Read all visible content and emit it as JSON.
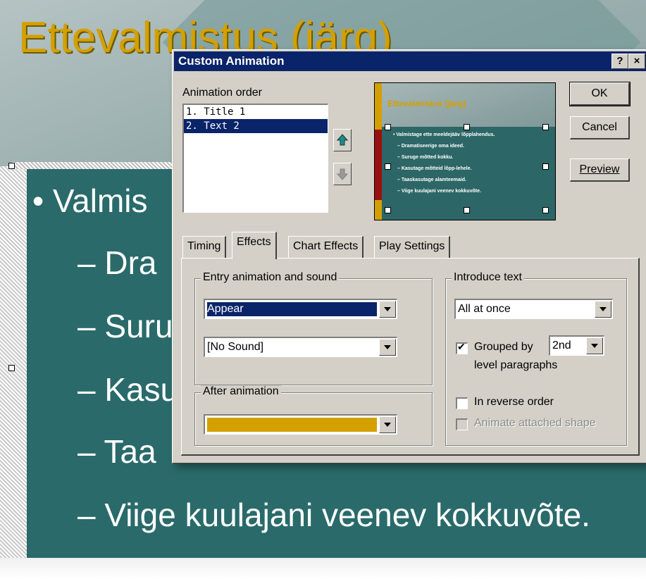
{
  "slide": {
    "title": "Ettevalmistus (järg)",
    "bullets": [
      "• Valmis",
      "– Dra",
      "– Suru",
      "– Kasu",
      "– Taa",
      "– Viige kuulajani veenev kokkuvõte."
    ]
  },
  "dialog": {
    "title": "Custom Animation",
    "help_button": "?",
    "close_button": "×",
    "animation_order_label": "Animation order",
    "order_items": [
      "1. Title 1",
      "2. Text 2"
    ],
    "selected_order_index": 1,
    "buttons": {
      "ok": "OK",
      "cancel": "Cancel",
      "preview": "Preview"
    },
    "preview": {
      "title": "Ettevalmistus (järg)",
      "lines": [
        "• Valmistage ette meeldejääv lõpplahendus.",
        "– Dramatiseerige oma ideed.",
        "– Suruge mõtted kokku.",
        "– Kasutage mõtteid lõpp-lehele.",
        "– Taaskasutage alamteemaid.",
        "– Viige kuulajani veenev kokkuvõte."
      ]
    },
    "tabs": [
      "Timing",
      "Effects",
      "Chart Effects",
      "Play Settings"
    ],
    "active_tab": "Effects",
    "entry": {
      "group_label": "Entry animation and sound",
      "effect_value": "Appear",
      "sound_value": "[No Sound]"
    },
    "after": {
      "group_label": "After animation",
      "color": "#d4a000"
    },
    "introduce": {
      "group_label": "Introduce text",
      "mode_value": "All at once",
      "grouped_by_label": "Grouped by",
      "grouped_by_value": "2nd",
      "grouped_by_checked": true,
      "level_label": "level paragraphs",
      "reverse_label": "In reverse order",
      "reverse_checked": false,
      "attached_label": "Animate attached shape",
      "attached_enabled": false
    }
  },
  "colors": {
    "title_gold": "#d4a000",
    "slide_teal": "#2a6a6a",
    "selection_navy": "#0a246a"
  }
}
